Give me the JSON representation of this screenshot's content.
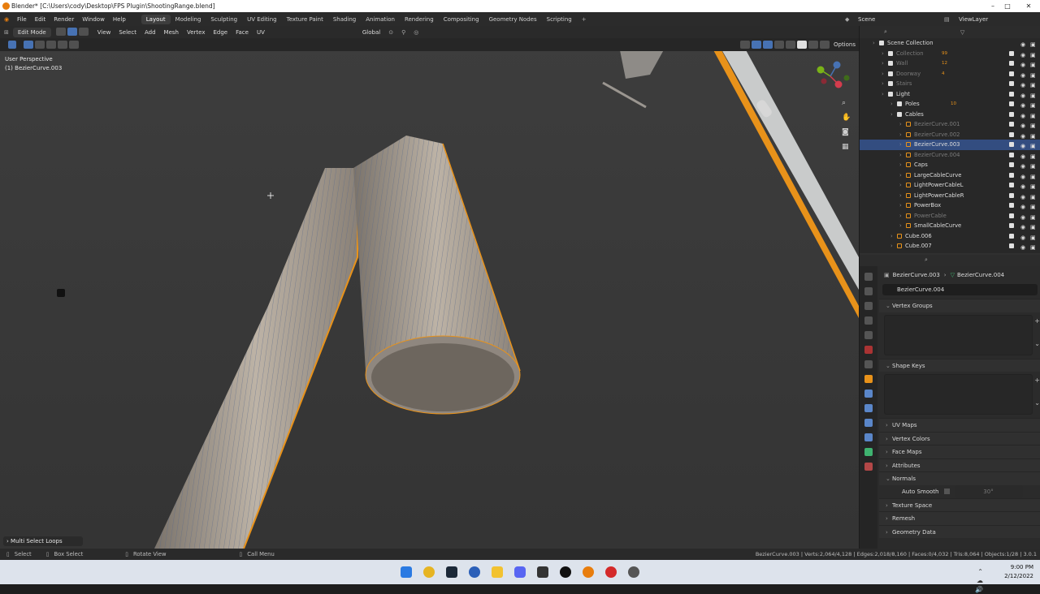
{
  "titlebar": {
    "title": "Blender* [C:\\Users\\cody\\Desktop\\FPS Plugin\\ShootingRange.blend]"
  },
  "menu": [
    "File",
    "Edit",
    "Render",
    "Window",
    "Help"
  ],
  "workspaces": [
    "Layout",
    "Modeling",
    "Sculpting",
    "UV Editing",
    "Texture Paint",
    "Shading",
    "Animation",
    "Rendering",
    "Compositing",
    "Geometry Nodes",
    "Scripting"
  ],
  "scene": {
    "label": "Scene",
    "viewlayer": "ViewLayer"
  },
  "viewport_header": {
    "mode": "Edit Mode",
    "items": [
      "View",
      "Select",
      "Add",
      "Mesh",
      "Vertex",
      "Edge",
      "Face",
      "UV"
    ],
    "orientation": "Global",
    "options": "Options",
    "axes": [
      "X",
      "Y",
      "Z"
    ]
  },
  "viewport": {
    "perspective": "User Perspective",
    "object": "(1) BezierCurve.003",
    "operator": "Multi Select Loops"
  },
  "outliner": {
    "rows": [
      {
        "label": "Scene Collection",
        "indent": 0,
        "dim": false,
        "sel": false,
        "kind": "collection",
        "badge": ""
      },
      {
        "label": "Collection",
        "indent": 1,
        "dim": true,
        "sel": false,
        "kind": "collection",
        "badge": "99"
      },
      {
        "label": "Wall",
        "indent": 1,
        "dim": true,
        "sel": false,
        "kind": "collection",
        "badge": "12"
      },
      {
        "label": "Doorway",
        "indent": 1,
        "dim": true,
        "sel": false,
        "kind": "collection",
        "badge": "4"
      },
      {
        "label": "Stairs",
        "indent": 1,
        "dim": true,
        "sel": false,
        "kind": "collection",
        "badge": ""
      },
      {
        "label": "Light",
        "indent": 1,
        "dim": false,
        "sel": false,
        "kind": "collection",
        "badge": ""
      },
      {
        "label": "Poles",
        "indent": 2,
        "dim": false,
        "sel": false,
        "kind": "collection",
        "badge": "10"
      },
      {
        "label": "Cables",
        "indent": 2,
        "dim": false,
        "sel": false,
        "kind": "collection",
        "badge": ""
      },
      {
        "label": "BezierCurve.001",
        "indent": 3,
        "dim": true,
        "sel": false,
        "kind": "curve",
        "badge": ""
      },
      {
        "label": "BezierCurve.002",
        "indent": 3,
        "dim": true,
        "sel": false,
        "kind": "curve",
        "badge": ""
      },
      {
        "label": "BezierCurve.003",
        "indent": 3,
        "dim": false,
        "sel": true,
        "kind": "mesh",
        "badge": ""
      },
      {
        "label": "BezierCurve.004",
        "indent": 3,
        "dim": true,
        "sel": false,
        "kind": "mesh",
        "badge": ""
      },
      {
        "label": "Caps",
        "indent": 3,
        "dim": false,
        "sel": false,
        "kind": "mesh",
        "badge": ""
      },
      {
        "label": "LargeCableCurve",
        "indent": 3,
        "dim": false,
        "sel": false,
        "kind": "curve",
        "badge": ""
      },
      {
        "label": "LightPowerCableL",
        "indent": 3,
        "dim": false,
        "sel": false,
        "kind": "mesh",
        "badge": ""
      },
      {
        "label": "LightPowerCableR",
        "indent": 3,
        "dim": false,
        "sel": false,
        "kind": "mesh",
        "badge": ""
      },
      {
        "label": "PowerBox",
        "indent": 3,
        "dim": false,
        "sel": false,
        "kind": "mesh",
        "badge": ""
      },
      {
        "label": "PowerCable",
        "indent": 3,
        "dim": true,
        "sel": false,
        "kind": "mesh",
        "badge": ""
      },
      {
        "label": "SmallCableCurve",
        "indent": 3,
        "dim": false,
        "sel": false,
        "kind": "curve",
        "badge": ""
      },
      {
        "label": "Cube.006",
        "indent": 2,
        "dim": false,
        "sel": false,
        "kind": "mesh",
        "badge": ""
      },
      {
        "label": "Cube.007",
        "indent": 2,
        "dim": false,
        "sel": false,
        "kind": "mesh",
        "badge": ""
      }
    ]
  },
  "properties": {
    "breadcrumb_object": "BezierCurve.003",
    "breadcrumb_data": "BezierCurve.004",
    "datablock": "BezierCurve.004",
    "sections": [
      {
        "label": "Vertex Groups",
        "open": true,
        "list": true
      },
      {
        "label": "Shape Keys",
        "open": true,
        "list": true
      },
      {
        "label": "UV Maps",
        "open": false,
        "list": false
      },
      {
        "label": "Vertex Colors",
        "open": false,
        "list": false
      },
      {
        "label": "Face Maps",
        "open": false,
        "list": false
      },
      {
        "label": "Attributes",
        "open": false,
        "list": false
      },
      {
        "label": "Normals",
        "open": true,
        "list": false
      },
      {
        "label": "Texture Space",
        "open": false,
        "list": false
      },
      {
        "label": "Remesh",
        "open": false,
        "list": false
      },
      {
        "label": "Geometry Data",
        "open": false,
        "list": false
      }
    ],
    "auto_smooth": {
      "label": "Auto Smooth",
      "value": "30°"
    }
  },
  "statusbar": {
    "select": "Select",
    "box_select": "Box Select",
    "rotate": "Rotate View",
    "call_menu": "Call Menu",
    "stats": "BezierCurve.003 | Verts:2,064/4,128 | Edges:2,018/8,160 | Faces:0/4,032 | Tris:8,064 | Objects:1/28 | 3.0.1"
  },
  "taskbar": {
    "time": "9:00 PM",
    "date": "2/12/2022"
  },
  "colors": {
    "accent": "#4772b3",
    "orange": "#e8921a",
    "selected_row": "#334d80"
  }
}
